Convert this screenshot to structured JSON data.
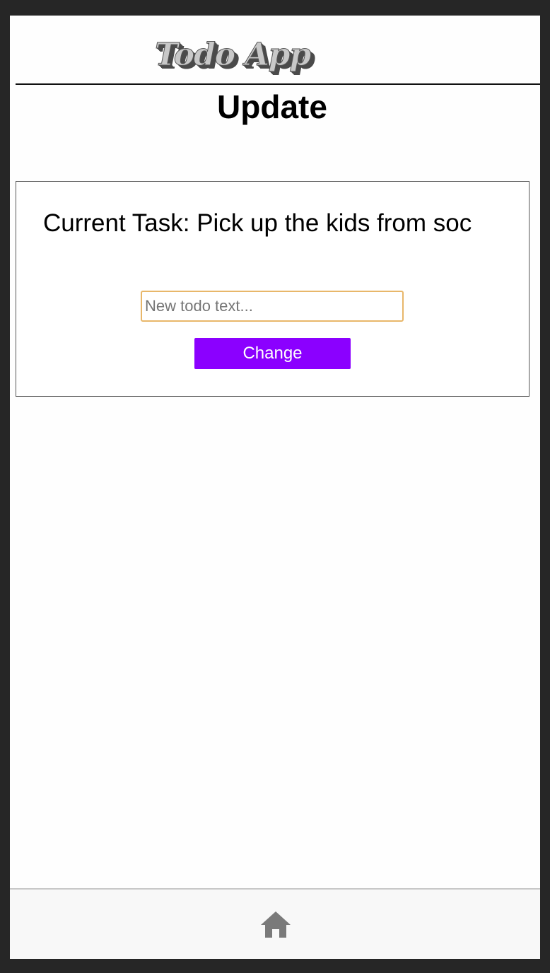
{
  "header": {
    "logo_text": "Todo App"
  },
  "page": {
    "title": "Update"
  },
  "card": {
    "current_task_label": "Current Task: Pick up the kids from soc",
    "input_placeholder": "New todo text...",
    "input_value": "",
    "change_label": "Change"
  },
  "bottom_nav": {
    "home_icon": "home-icon"
  },
  "colors": {
    "accent_button": "#8B00FF",
    "input_focus_border": "#E8B76A",
    "background": "#FEFEFE",
    "frame": "#262626"
  }
}
